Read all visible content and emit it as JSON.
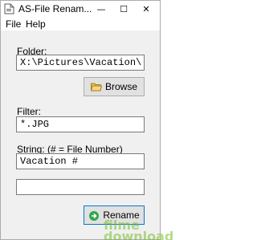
{
  "window": {
    "title": "AS-File Renam...",
    "minimize_glyph": "—",
    "maximize_glyph": "☐",
    "close_glyph": "✕"
  },
  "menu": {
    "items": [
      {
        "label": "File"
      },
      {
        "label": "Help"
      }
    ]
  },
  "form": {
    "folder_label": "Folder:",
    "folder_value": "X:\\Pictures\\Vacation\\",
    "browse_label": "Browse",
    "filter_label": "Filter:",
    "filter_value": "*.JPG",
    "string_label": "String: (# = File Number)",
    "string_value": "Vacation #",
    "status_value": "",
    "rename_label": "Rename"
  },
  "icons": {
    "app": "app-document-icon",
    "browse": "folder-open-icon",
    "rename": "go-arrow-icon"
  },
  "watermark": {
    "line1": "filme",
    "line2": "download"
  },
  "colors": {
    "window_bg": "#f0f0f0",
    "button_bg": "#e1e1e1",
    "focus_border": "#0078d7",
    "rename_icon": "#2fa84f"
  }
}
